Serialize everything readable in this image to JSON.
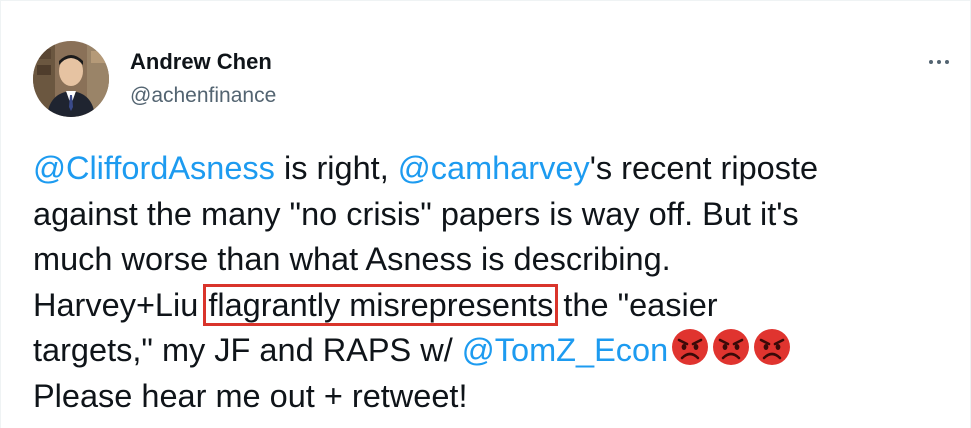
{
  "author": {
    "name": "Andrew Chen",
    "handle": "@achenfinance",
    "avatar_icon": "avatar-photo"
  },
  "more_icon": "more-horizontal-icon",
  "tweet": {
    "line1": {
      "mention1": "@CliffordAsness",
      "text1": " is right, ",
      "mention2": "@camharvey",
      "text2": "'s recent riposte"
    },
    "line2": "against the many \"no crisis\" papers is way off.  But it's",
    "line3": "much worse than what Asness is describing.",
    "line4": {
      "text1": "Harvey+Liu ",
      "highlighted": "flagrantly misrepresents",
      "text2": " the \"easier"
    },
    "line5": {
      "text1": "targets,\" my JF and RAPS w/ ",
      "mention": "@TomZ_Econ",
      "emoji": [
        "angry-face",
        "angry-face",
        "angry-face"
      ]
    },
    "line6": "Please hear me out + retweet!"
  },
  "colors": {
    "mention": "#1d9bf0",
    "text": "#0f1419",
    "secondary": "#536471",
    "highlight_box": "#d9342b",
    "emoji_red": "#e0342f"
  }
}
